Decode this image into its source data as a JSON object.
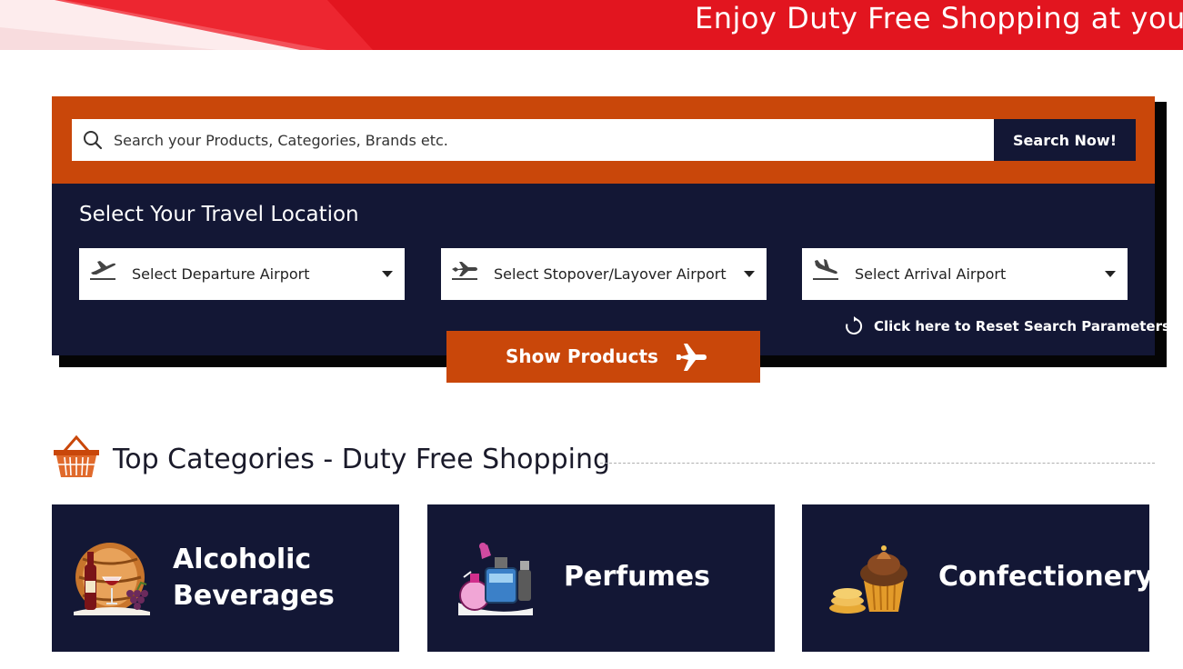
{
  "banner": {
    "text": "Enjoy Duty Free Shopping at your",
    "color": "#e2151f"
  },
  "search": {
    "placeholder": "Search your Products, Categories, Brands etc.",
    "button_label": "Search Now!",
    "icon": "search-icon"
  },
  "travel": {
    "title": "Select Your Travel Location",
    "selects": [
      {
        "label": "Select Departure Airport",
        "icon": "departure-plane-icon"
      },
      {
        "label": "Select Stopover/Layover Airport",
        "icon": "stopover-plane-icon"
      },
      {
        "label": "Select Arrival Airport",
        "icon": "arrival-plane-icon"
      }
    ],
    "reset_label": "Click here to Reset Search Parameters",
    "show_products_label": "Show Products"
  },
  "categories": {
    "heading": "Top Categories - Duty Free Shopping",
    "items": [
      {
        "line1": "Alcoholic",
        "line2": "Beverages",
        "icon": "wine-barrel-icon"
      },
      {
        "line1": "Perfumes",
        "line2": "",
        "icon": "perfume-bottles-icon"
      },
      {
        "line1": "Confectionery",
        "line2": "",
        "icon": "cupcake-icon"
      }
    ]
  },
  "colors": {
    "accent_orange": "#c9470a",
    "navy": "#131735",
    "banner_red": "#e2151f"
  }
}
